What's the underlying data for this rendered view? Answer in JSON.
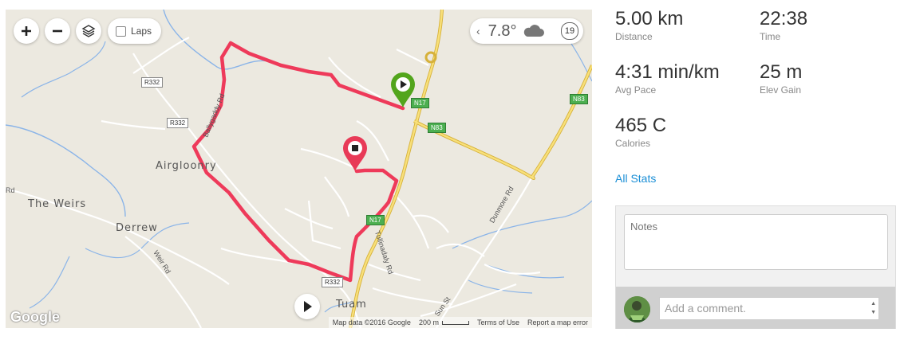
{
  "map": {
    "laps_label": "Laps",
    "weather": {
      "temperature": "7.8°",
      "condition_icon": "cloud-icon",
      "wind_speed": "19"
    },
    "places": {
      "airgloonry": "Airgloonry",
      "the_weirs": "The Weirs",
      "derrew": "Derrew",
      "tuam": "Tuam"
    },
    "roads": {
      "r332_a": "R332",
      "r332_b": "R332",
      "r332_c": "R332",
      "n17_a": "N17",
      "n17_b": "N17",
      "n83_a": "N83",
      "n83_b": "N83",
      "ballygaddy_rd": "Ballygaddy Rd",
      "tullinadaly_rd": "Tullinadaly Rd",
      "weir_rd": "Weir Rd",
      "dunmore_rd": "Dunmore Rd",
      "sun_st": "Sun St",
      "edge_rd": "Rd"
    },
    "footer": {
      "map_data": "Map data ©2016 Google",
      "scale": "200 m",
      "terms": "Terms of Use",
      "report": "Report a map error"
    },
    "google_logo": "Google",
    "route_color": "#ee3a5a",
    "start_marker_color": "#52a51c",
    "end_marker_color": "#e83a57"
  },
  "stats": [
    {
      "value": "5.00 km",
      "label": "Distance"
    },
    {
      "value": "22:38",
      "label": "Time"
    },
    {
      "value": "4:31 min/km",
      "label": "Avg Pace"
    },
    {
      "value": "25 m",
      "label": "Elev Gain"
    },
    {
      "value": "465 C",
      "label": "Calories"
    }
  ],
  "all_stats_label": "All Stats",
  "notes": {
    "placeholder": "Notes"
  },
  "comment": {
    "placeholder": "Add a comment."
  }
}
